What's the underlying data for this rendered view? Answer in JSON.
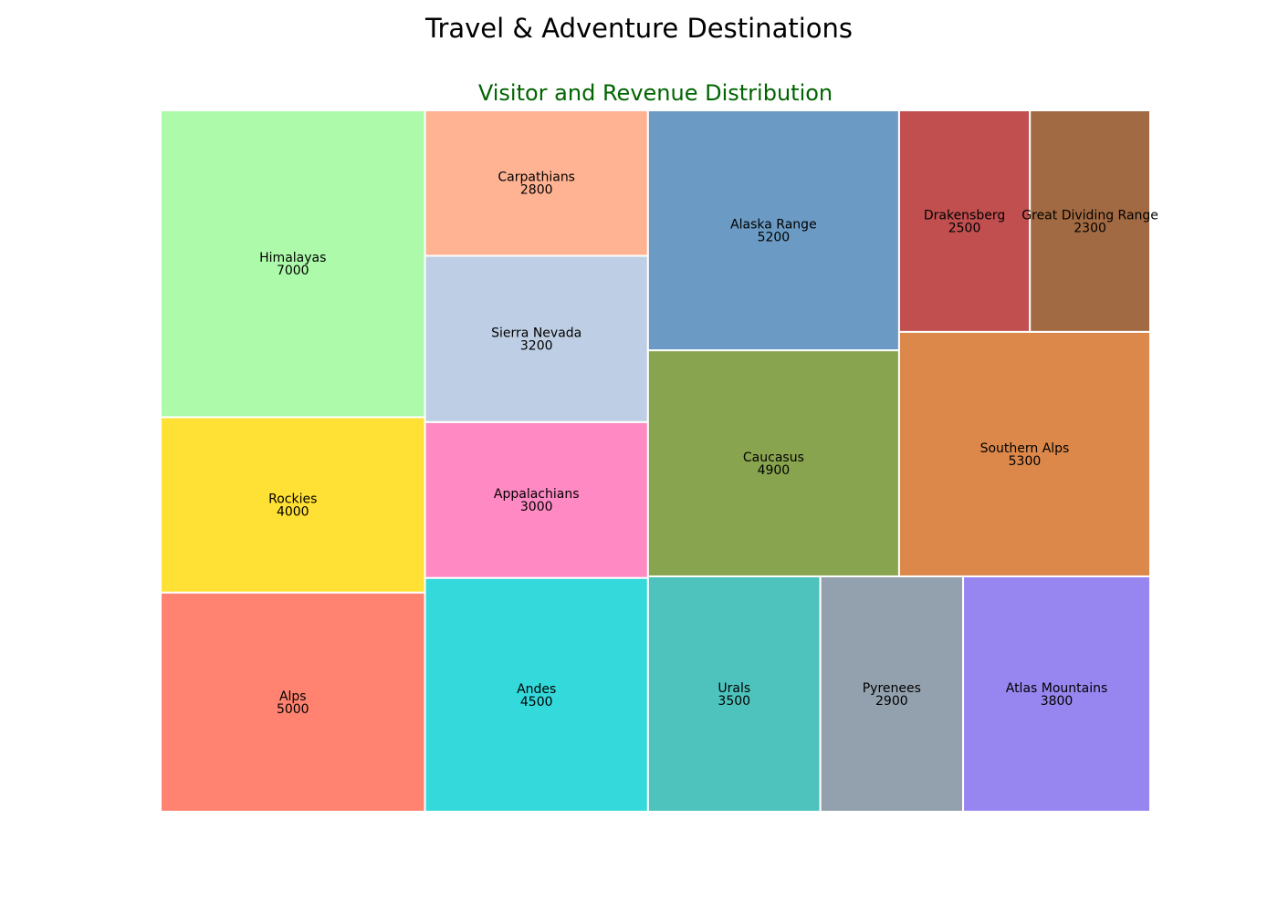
{
  "figure": {
    "title": "Travel & Adventure Destinations"
  },
  "chart_data": {
    "type": "treemap",
    "title": "Visitor and Revenue Distribution",
    "title_color": "#006400",
    "items": [
      {
        "label": "Alps",
        "value": 5000,
        "color": "#FF8370"
      },
      {
        "label": "Rockies",
        "value": 4000,
        "color": "#FFE034"
      },
      {
        "label": "Himalayas",
        "value": 7000,
        "color": "#ADFBAA"
      },
      {
        "label": "Andes",
        "value": 4500,
        "color": "#34D9DB"
      },
      {
        "label": "Appalachians",
        "value": 3000,
        "color": "#FF89C3"
      },
      {
        "label": "Sierra Nevada",
        "value": 3200,
        "color": "#BECFE5"
      },
      {
        "label": "Carpathians",
        "value": 2800,
        "color": "#FFB393"
      },
      {
        "label": "Urals",
        "value": 3500,
        "color": "#4EC3BD"
      },
      {
        "label": "Pyrenees",
        "value": 2900,
        "color": "#93A1AE"
      },
      {
        "label": "Atlas Mountains",
        "value": 3800,
        "color": "#9886F0"
      },
      {
        "label": "Caucasus",
        "value": 4900,
        "color": "#89A44F"
      },
      {
        "label": "Alaska Range",
        "value": 5200,
        "color": "#6B9BC4"
      },
      {
        "label": "Southern Alps",
        "value": 5300,
        "color": "#DC884A"
      },
      {
        "label": "Drakensberg",
        "value": 2500,
        "color": "#C14F4F"
      },
      {
        "label": "Great Dividing Range",
        "value": 2300,
        "color": "#A26A42"
      }
    ]
  }
}
